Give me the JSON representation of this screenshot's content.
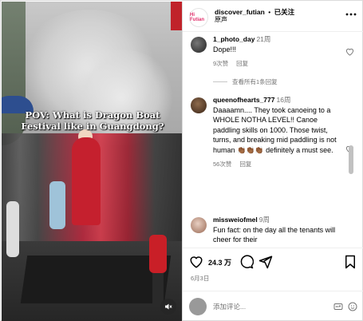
{
  "media": {
    "caption": "POV: What is Dragon Boat Festival like in Guangdong?"
  },
  "header": {
    "username": "discover_futian",
    "separator": "•",
    "follow_status": "已关注",
    "subtitle": "原声",
    "logo_text": "Hi Futian"
  },
  "comments": [
    {
      "username": "1_photo_day",
      "time": "21周",
      "text": "Dope!!!",
      "likes": "9次赞",
      "reply": "回复"
    },
    {
      "username": "queenofhearts_777",
      "time": "16周",
      "text": "Daaaamn.... They took canoeing to a WHOLE NOTHA LEVEL!! Canoe paddling skills on 1000. Those twist, turns, and breaking mid paddling is not human 👏🏾👏🏾👏🏾 definitely a must see.",
      "likes": "56次赞",
      "reply": "回复"
    },
    {
      "username": "missweiofmel",
      "time": "9周",
      "text": "Fun fact: on the day all the tenants will cheer for their"
    }
  ],
  "view_replies": "查看所有1条回复",
  "actions": {
    "likes_count": "24.3 万",
    "date": "6月3日"
  },
  "add_comment": {
    "placeholder": "添加评论..."
  },
  "colors": {
    "accent_red": "#c0232a",
    "muted_text": "#737373",
    "border": "#dbdbdb"
  },
  "icons": [
    "more-icon",
    "heart-icon",
    "comment-icon",
    "share-icon",
    "save-icon",
    "mute-icon",
    "gif-icon",
    "emoji-icon"
  ]
}
